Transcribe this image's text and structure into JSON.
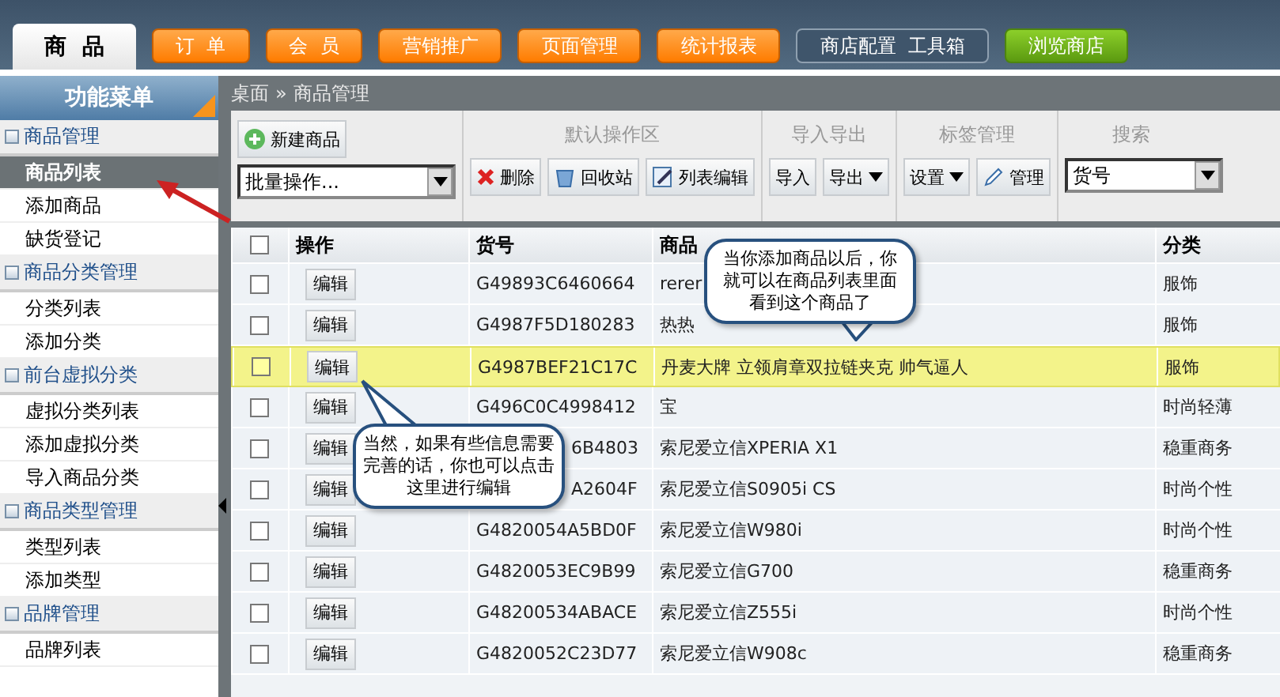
{
  "top_tabs": [
    {
      "label": "商  品",
      "kind": "tab",
      "selected": true
    },
    {
      "label": "订  单",
      "kind": "tab",
      "selected": false
    },
    {
      "label": "会  员",
      "kind": "tab",
      "selected": false
    },
    {
      "label": "营销推广",
      "kind": "tab",
      "selected": false
    },
    {
      "label": "页面管理",
      "kind": "tab",
      "selected": false
    },
    {
      "label": "统计报表",
      "kind": "tab",
      "selected": false
    },
    {
      "label": "商店配置  工具箱",
      "kind": "outline",
      "selected": false
    },
    {
      "label": "浏览商店",
      "kind": "green",
      "selected": false
    }
  ],
  "sidebar": {
    "title": "功能菜单",
    "groups": [
      {
        "label": "商品管理",
        "children": [
          {
            "label": "商品列表",
            "selected": true
          },
          {
            "label": "添加商品",
            "selected": false
          },
          {
            "label": "缺货登记",
            "selected": false
          }
        ]
      },
      {
        "label": "商品分类管理",
        "children": [
          {
            "label": "分类列表",
            "selected": false
          },
          {
            "label": "添加分类",
            "selected": false
          }
        ]
      },
      {
        "label": "前台虚拟分类",
        "children": [
          {
            "label": "虚拟分类列表",
            "selected": false
          },
          {
            "label": "添加虚拟分类",
            "selected": false
          },
          {
            "label": "导入商品分类",
            "selected": false
          }
        ]
      },
      {
        "label": "商品类型管理",
        "children": [
          {
            "label": "类型列表",
            "selected": false
          },
          {
            "label": "添加类型",
            "selected": false
          }
        ]
      },
      {
        "label": "品牌管理",
        "children": [
          {
            "label": "品牌列表",
            "selected": false
          }
        ]
      }
    ]
  },
  "breadcrumb": {
    "home": "桌面",
    "separator": "»",
    "current": "商品管理"
  },
  "toolbar": {
    "new_button": "新建商品",
    "batch_select": "批量操作...",
    "sections": [
      {
        "title": "默认操作区",
        "buttons": [
          "删除",
          "回收站",
          "列表编辑"
        ]
      },
      {
        "title": "导入导出",
        "buttons": [
          "导入",
          "导出"
        ]
      },
      {
        "title": "标签管理",
        "buttons": [
          "设置",
          "管理"
        ]
      }
    ],
    "search": {
      "title": "搜索",
      "field": "货号"
    }
  },
  "table": {
    "select_all_checked": false,
    "columns": [
      "操作",
      "货号",
      "商品",
      "分类"
    ],
    "rows": [
      {
        "action": "编辑",
        "sku": "G49893C6460664",
        "name": "rerer",
        "category": "服饰",
        "highlighted": false,
        "partial_sku": false
      },
      {
        "action": "编辑",
        "sku": "G4987F5D180283",
        "name": "热热",
        "category": "服饰",
        "highlighted": false,
        "partial_sku": false
      },
      {
        "action": "编辑",
        "sku": "G4987BEF21C17C",
        "name": "丹麦大牌 立领肩章双拉链夹克 帅气逼人",
        "category": "服饰",
        "highlighted": true,
        "partial_sku": false
      },
      {
        "action": "编辑",
        "sku": "G496C0C4998412",
        "name": "宝",
        "category": "时尚轻薄",
        "highlighted": false,
        "partial_sku": false
      },
      {
        "action": "编辑",
        "sku": "6B4803",
        "name": "索尼爱立信XPERIA X1",
        "category": "稳重商务",
        "highlighted": false,
        "partial_sku": true
      },
      {
        "action": "编辑",
        "sku": "A2604F",
        "name": "索尼爱立信S0905i CS",
        "category": "时尚个性",
        "highlighted": false,
        "partial_sku": true
      },
      {
        "action": "编辑",
        "sku": "G4820054A5BD0F",
        "name": "索尼爱立信W980i",
        "category": "时尚个性",
        "highlighted": false,
        "partial_sku": false
      },
      {
        "action": "编辑",
        "sku": "G4820053EC9B99",
        "name": "索尼爱立信G700",
        "category": "稳重商务",
        "highlighted": false,
        "partial_sku": false
      },
      {
        "action": "编辑",
        "sku": "G48200534ABACE",
        "name": "索尼爱立信Z555i",
        "category": "时尚个性",
        "highlighted": false,
        "partial_sku": false
      },
      {
        "action": "编辑",
        "sku": "G4820052C23D77",
        "name": "索尼爱立信W908c",
        "category": "稳重商务",
        "highlighted": false,
        "partial_sku": false
      }
    ]
  },
  "callouts": [
    {
      "text": "当你添加商品以后，你就可以在商品列表里面看到这个商品了",
      "kind": "tail_down"
    },
    {
      "text": "当然，如果有些信息需要完善的话，你也可以点击这里进行编辑",
      "kind": "tail_up"
    }
  ]
}
